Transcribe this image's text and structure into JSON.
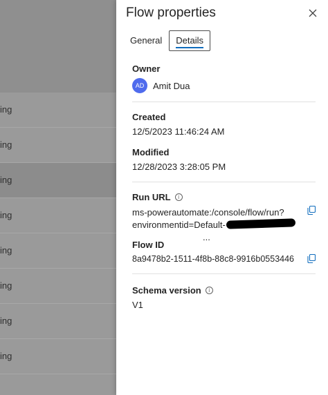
{
  "background_list": {
    "rows": [
      "ing",
      "ing",
      "ing",
      "ing",
      "ing",
      "ing",
      "ing",
      "ing"
    ]
  },
  "panel": {
    "title": "Flow properties",
    "tabs": [
      {
        "label": "General",
        "active": false
      },
      {
        "label": "Details",
        "active": true
      }
    ],
    "owner": {
      "label": "Owner",
      "initials": "AD",
      "name": "Amit Dua"
    },
    "created": {
      "label": "Created",
      "value": "12/5/2023 11:46:24 AM"
    },
    "modified": {
      "label": "Modified",
      "value": "12/28/2023 3:28:05 PM"
    },
    "run_url": {
      "label": "Run URL",
      "line1": "ms-powerautomate:/console/flow/run?",
      "line2": "environmentid=Default-",
      "ellipsis": "..."
    },
    "flow_id": {
      "label": "Flow ID",
      "value": "8a9478b2-1511-4f8b-88c8-9916b0553446"
    },
    "schema_version": {
      "label": "Schema version",
      "value": "V1"
    }
  },
  "colors": {
    "accent": "#0f6cbd",
    "avatar": "#4f6bed",
    "overlay": "#9a9a9a"
  }
}
